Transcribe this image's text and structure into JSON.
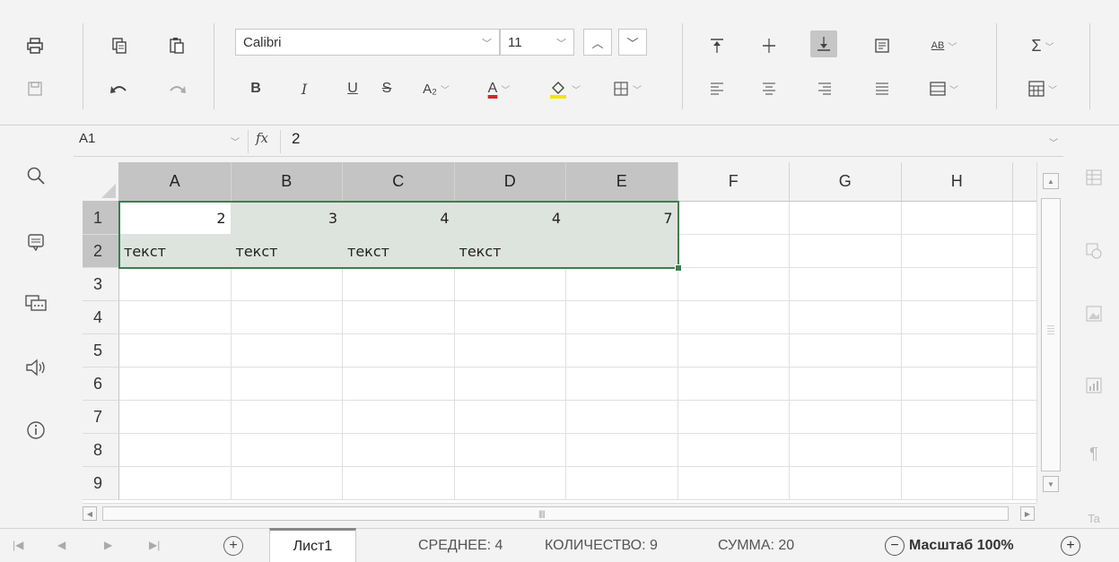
{
  "toolbar": {
    "font_name": "Calibri",
    "font_size": "11",
    "bold": "B",
    "italic": "I",
    "underline": "U",
    "strikethrough": "S",
    "subscript": "A₂",
    "font_color_letter": "A",
    "font_color": "#d9252a",
    "fill_color": "#f2e600",
    "wrap_text_icon": "AB",
    "sum_icon": "Σ"
  },
  "formula_bar": {
    "name_box": "A1",
    "fx": "fx",
    "value": "2"
  },
  "grid": {
    "columns": [
      "A",
      "B",
      "C",
      "D",
      "E",
      "F",
      "G",
      "H"
    ],
    "rows": [
      "1",
      "2",
      "3",
      "4",
      "5",
      "6",
      "7",
      "8",
      "9"
    ],
    "cells": {
      "A1": "2",
      "B1": "3",
      "C1": "4",
      "D1": "4",
      "E1": "7",
      "A2": "текст",
      "B2": "текст",
      "C2": "текст",
      "D2": "текст"
    },
    "selection": "A1:E2",
    "selection_color": "#3f7d4e"
  },
  "statusbar": {
    "sheet_tab": "Лист1",
    "average": "СРЕДНЕЕ: 4",
    "count": "КОЛИЧЕСТВО: 9",
    "sum": "СУММА: 20",
    "zoom": "Масштаб 100%"
  }
}
